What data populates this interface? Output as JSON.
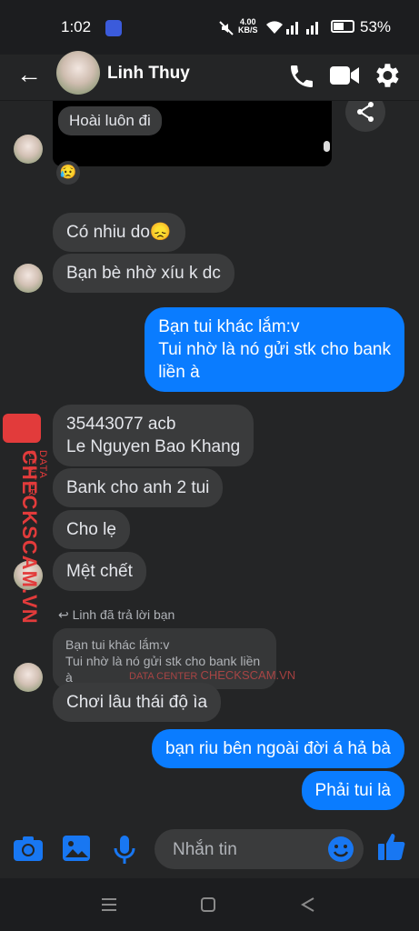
{
  "status": {
    "time": "1:02",
    "net": "4.00",
    "net_unit": "KB/S",
    "battery": "53%"
  },
  "header": {
    "contact_name": "Linh Thuy"
  },
  "messages": {
    "shared_reply": "Hoài luôn đi",
    "reaction": "😥",
    "m1": "Có nhiu do😞",
    "m2": "Bạn bè nhờ xíu k dc",
    "m3_line1": "Bạn tui khác lắm:v",
    "m3_line2": "Tui nhờ là nó gửi stk cho bank",
    "m3_line3": "liền à",
    "m4_line1": "35443077 acb",
    "m4_line2": "Le Nguyen Bao Khang",
    "m5": "Bank cho anh 2 tui",
    "m6": "Cho lẹ",
    "m7": "Mệt chết",
    "reply_note": "Linh đã trả lời bạn",
    "quoted_line1": "Bạn tui khác lắm:v",
    "quoted_line2": "Tui nhờ là nó gửi stk cho bank liền à",
    "m8": "Chơi lâu thái độ ìa",
    "m9": "bạn riu bên ngoài đời á hả bà",
    "m10": "Phải tui là"
  },
  "watermark": {
    "brand": "CHECKSCAM.VN",
    "sub": "DATA CENTER",
    "small_brand": "CHECKSCAM.VN",
    "small_sub": "DATA CENTER"
  },
  "composer": {
    "placeholder": "Nhắn tin"
  },
  "colors": {
    "accent": "#0a7cff",
    "bubble_in": "#3a3b3c",
    "background": "#242526"
  }
}
